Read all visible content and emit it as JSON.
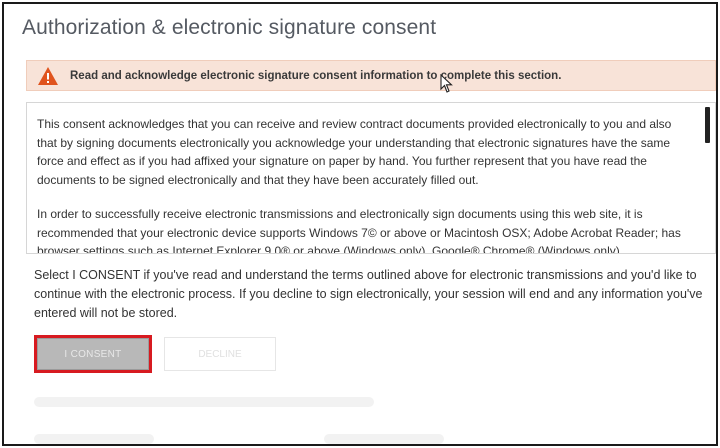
{
  "section": {
    "title": "Authorization & electronic signature consent"
  },
  "alert": {
    "icon": "warning-icon",
    "message": "Read and acknowledge electronic signature consent information to complete this section.",
    "accent_color": "#f8e3d8"
  },
  "consent_text": {
    "paragraph_1": "This consent acknowledges that you can receive and review contract documents provided electronically to you and also that by signing documents electronically you acknowledge your understanding that electronic signatures have the same force and effect as if you had affixed your signature on paper by hand. You further represent that you have read the documents to be signed electronically and that they have been accurately filled out.",
    "paragraph_2": "In order to successfully receive electronic transmissions and electronically sign documents using this web site, it is recommended that your electronic device supports Windows 7© or above or Macintosh OSX; Adobe Acrobat Reader; has browser settings such as Internet Explorer 9.0® or above (Windows only), Google® Chrome® (Windows only)..."
  },
  "prompt": {
    "text": "Select I CONSENT if you've read and understand the terms outlined above for electronic transmissions and you'd like to continue with the electronic process. If you decline to sign electronically, your session will end and any information you've entered will not be stored."
  },
  "buttons": {
    "consent_label": "I CONSENT",
    "decline_label": "DECLINE",
    "highlight_color": "#d71a20"
  }
}
